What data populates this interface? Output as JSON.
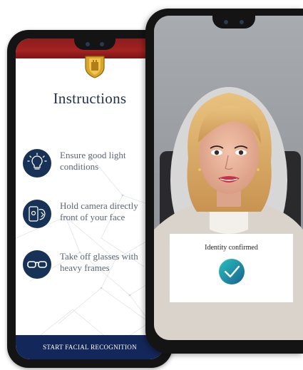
{
  "instructions": {
    "title": "Instructions",
    "items": [
      {
        "icon": "lightbulb-icon",
        "line1": "Ensure good light",
        "line2": "conditions"
      },
      {
        "icon": "phone-camera-icon",
        "line1": "Hold camera directly",
        "line2": "front of your face"
      },
      {
        "icon": "glasses-icon",
        "line1": "Take off glasses with",
        "line2": "heavy frames"
      }
    ],
    "start_button": "START FACIAL RECOGNITION"
  },
  "verification": {
    "status_text": "Identity confirmed",
    "status_icon": "checkmark-icon"
  },
  "colors": {
    "brand_navy": "#173256",
    "header_red": "#a42222",
    "button_navy": "#14275a",
    "check_teal": "#16a2a8"
  }
}
